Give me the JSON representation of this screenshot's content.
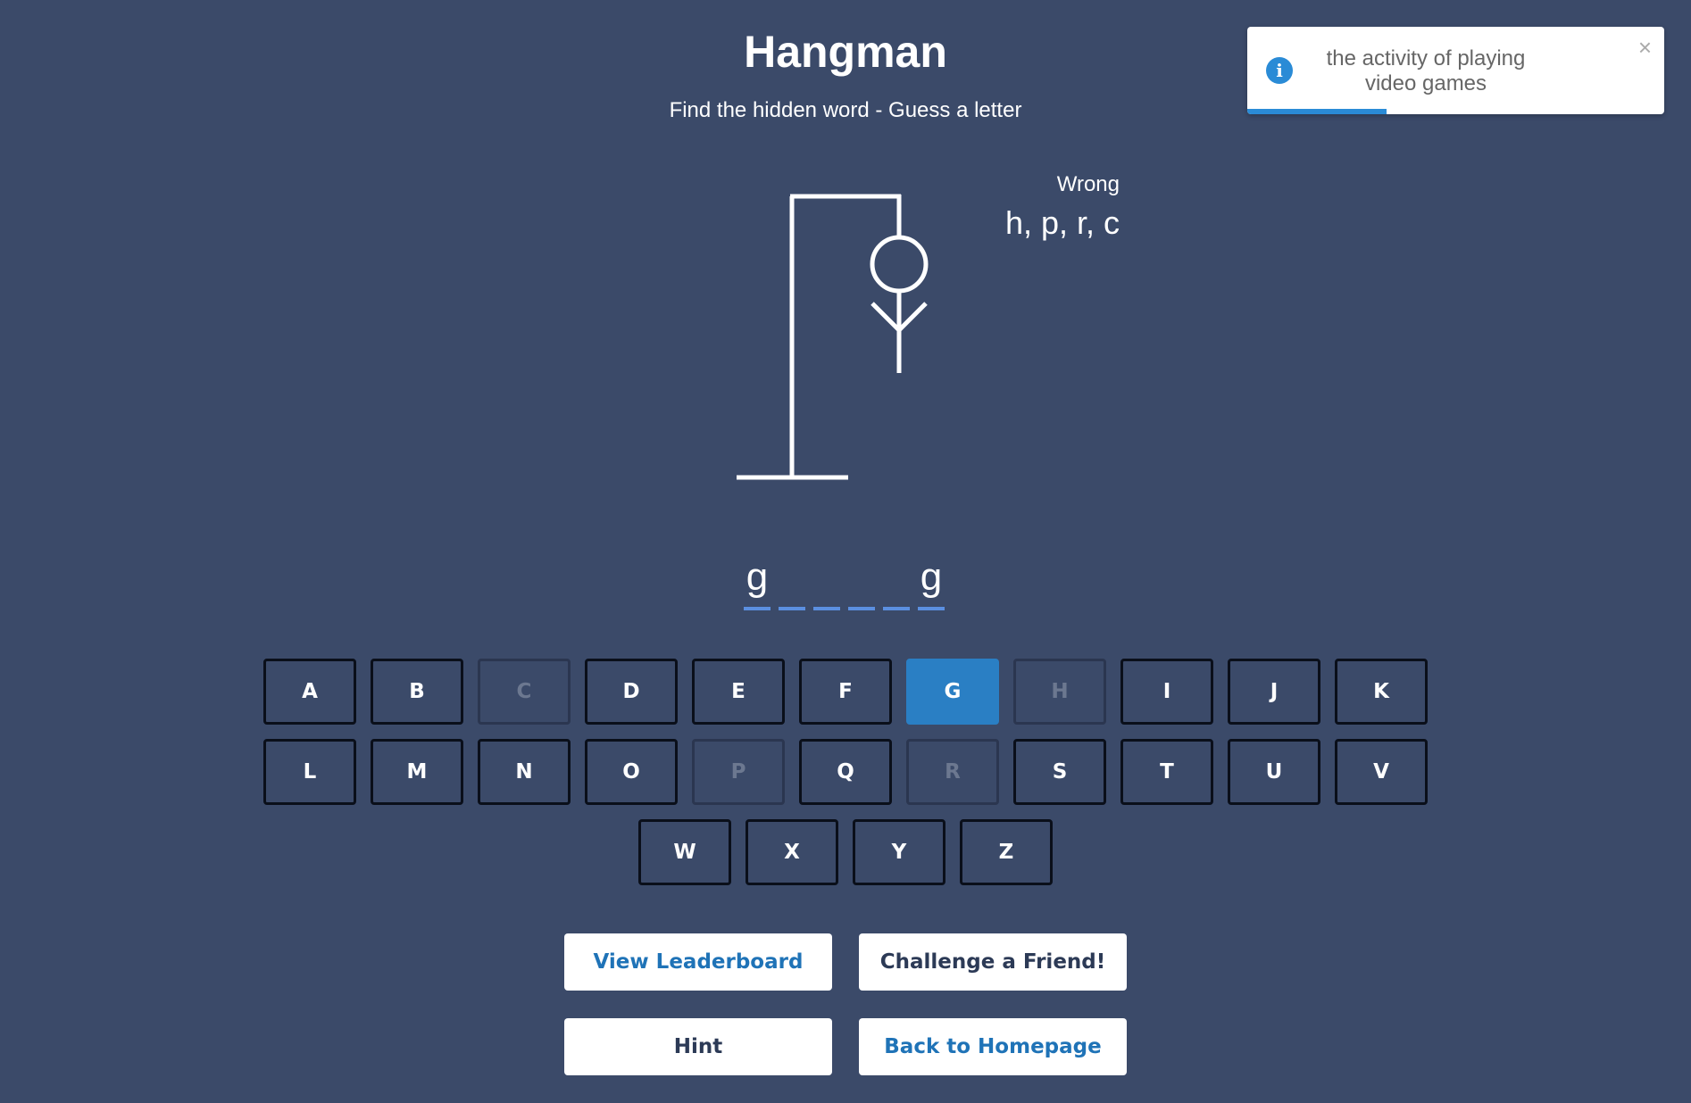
{
  "game": {
    "title": "Hangman",
    "subtitle": "Find the hidden word - Guess a letter"
  },
  "wrong": {
    "label": "Wrong",
    "letters": "h, p, r, c"
  },
  "word": {
    "slots": [
      "g",
      "",
      "",
      "",
      "",
      "g"
    ]
  },
  "keyboard": {
    "rows": [
      [
        "A",
        "B",
        "C",
        "D",
        "E",
        "F",
        "G",
        "H",
        "I",
        "J",
        "K"
      ],
      [
        "L",
        "M",
        "N",
        "O",
        "P",
        "Q",
        "R",
        "S",
        "T",
        "U",
        "V"
      ],
      [
        "W",
        "X",
        "Y",
        "Z"
      ]
    ],
    "used_wrong": [
      "C",
      "H",
      "P",
      "R"
    ],
    "correct": [
      "G"
    ]
  },
  "buttons": {
    "leaderboard": "View Leaderboard",
    "challenge": "Challenge a Friend!",
    "hint": "Hint",
    "homepage": "Back to Homepage"
  },
  "toast": {
    "icon": "info-icon",
    "text": "the activity of playing video games",
    "close_symbol": "×",
    "progress": 0.335
  },
  "colors": {
    "background": "#3b4a69",
    "accent": "#2a7fc4",
    "word_underline": "#5b8fe0"
  }
}
